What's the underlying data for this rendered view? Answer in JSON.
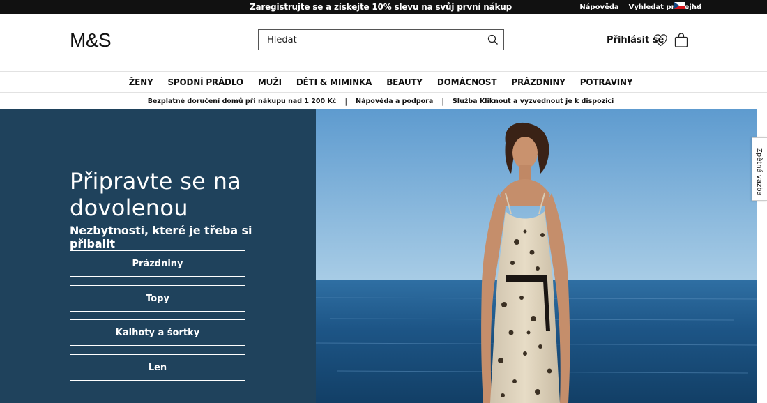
{
  "topbar": {
    "promo": "Zaregistrujte se a získejte 10% slevu na svůj první nákup",
    "help": "Nápověda",
    "store_locator": "Vyhledat prodejnu",
    "flag_icon": "czech-flag-icon",
    "chevron_icon": "chevron-down-icon"
  },
  "header": {
    "logo": "M&S",
    "search_placeholder": "Hledat",
    "search_icon": "search-icon",
    "signin": "Přihlásit se",
    "wishlist_icon": "heart-icon",
    "bag_icon": "shopping-bag-icon"
  },
  "nav": {
    "items": [
      {
        "label": "ŽENY"
      },
      {
        "label": "SPODNÍ PRÁDLO"
      },
      {
        "label": "MUŽI"
      },
      {
        "label": "DĚTI & MIMINKA"
      },
      {
        "label": "BEAUTY"
      },
      {
        "label": "DOMÁCNOST"
      },
      {
        "label": "PRÁZDNINY"
      },
      {
        "label": "POTRAVINY"
      }
    ]
  },
  "strip": {
    "items": [
      {
        "label": "Bezplatné doručení domů při nákupu nad 1 200 Kč"
      },
      {
        "label": "Nápověda a podpora"
      },
      {
        "label": "Služba Kliknout a vyzvednout je k dispozici"
      }
    ],
    "separator": "|"
  },
  "hero": {
    "title": "Připravte se na dovolenou",
    "subtitle": "Nezbytnosti, které je třeba si přibalit",
    "buttons": [
      {
        "label": "Prázdniny"
      },
      {
        "label": "Topy"
      },
      {
        "label": "Kalhoty a šortky"
      },
      {
        "label": "Len"
      }
    ]
  },
  "feedback": {
    "label": "Zpětná vazba"
  },
  "colors": {
    "topbar_bg": "#111111",
    "hero_panel": "#1f425c",
    "sky": "#7fb3d9",
    "sea": "#1b4f80"
  }
}
